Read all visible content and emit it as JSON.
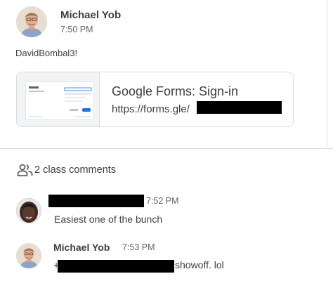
{
  "post": {
    "author": "Michael Yob",
    "time": "7:50 PM",
    "text": "DavidBombal3!",
    "attachment": {
      "title": "Google Forms: Sign-in",
      "url": "https://forms.gle/"
    }
  },
  "comments_header": {
    "label": "2 class comments"
  },
  "comments": [
    {
      "time": "7:52 PM",
      "text": "Easiest one of the bunch"
    },
    {
      "author": "Michael Yob",
      "time": "7:53 PM",
      "text_prefix": "+",
      "text": "showoff.  lol"
    }
  ],
  "colors": {
    "text": "#3c4043",
    "secondary_text": "#5f6368",
    "border": "#dadce0",
    "redaction": "#000000"
  }
}
